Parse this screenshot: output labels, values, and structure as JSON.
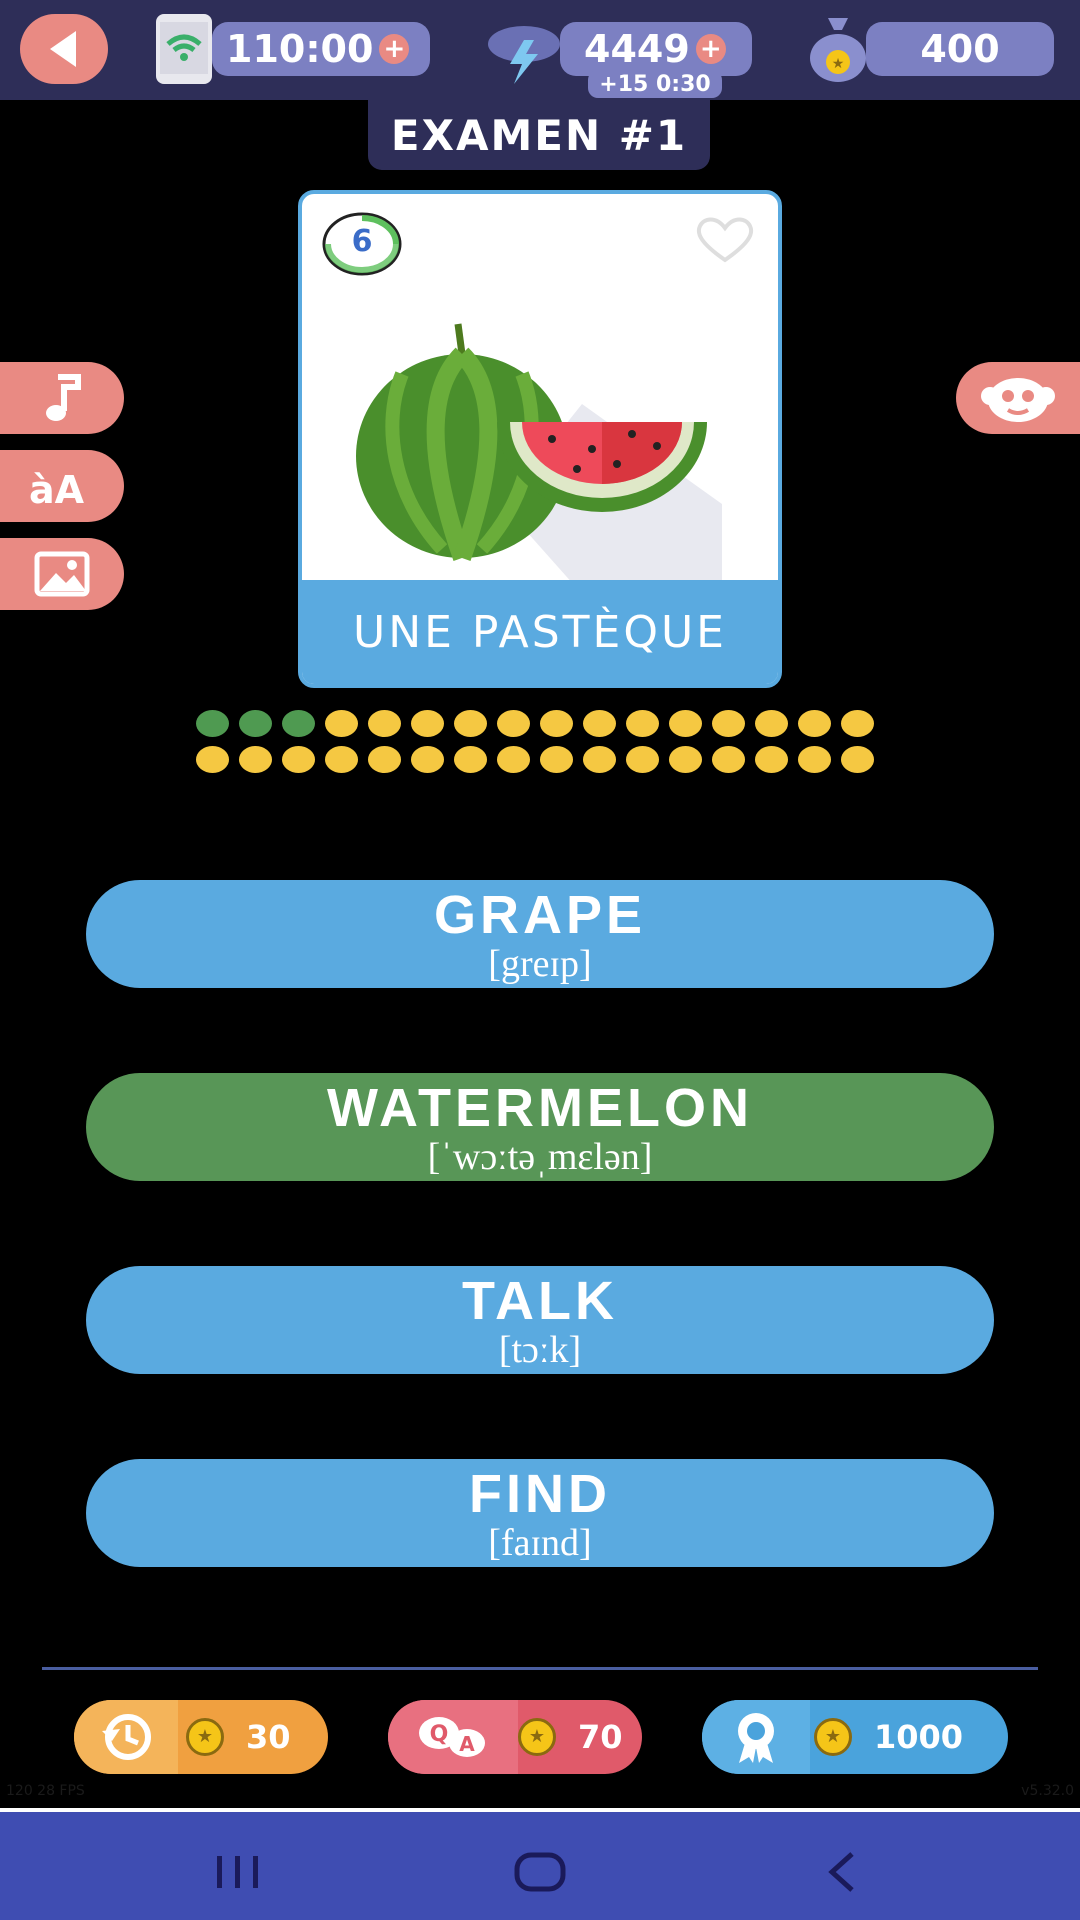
{
  "status_bar": {
    "back_icon": "back-arrow-icon",
    "timer": "110:00",
    "energy": "4449",
    "energy_refill": "+15 0:30",
    "coins": "400",
    "plus_symbol": "+"
  },
  "exam_title": "EXAMEN #1",
  "card": {
    "level": "6",
    "word": "UNE PASTÈQUE",
    "image": "watermelon"
  },
  "side_tools": {
    "left": [
      "music-note-icon",
      "translate-icon",
      "image-icon"
    ],
    "right": "mascot-icon"
  },
  "progress": {
    "total": 32,
    "completed": 3,
    "colors": {
      "done": "#4f9a51",
      "todo": "#f5c842"
    }
  },
  "answers": [
    {
      "word": "GRAPE",
      "phonetic": "[greɪp]",
      "state": "normal"
    },
    {
      "word": "WATERMELON",
      "phonetic": "[ˈwɔːtəˌmɛlən]",
      "state": "correct"
    },
    {
      "word": "TALK",
      "phonetic": "[tɔːk]",
      "state": "normal"
    },
    {
      "word": "FIND",
      "phonetic": "[faɪnd]",
      "state": "normal"
    }
  ],
  "bonuses": [
    {
      "icon": "time-rewind-icon",
      "cost": "30",
      "color": "#f0a040"
    },
    {
      "icon": "qa-hint-icon",
      "cost": "70",
      "color": "#e05a6a"
    },
    {
      "icon": "award-ribbon-icon",
      "cost": "1000",
      "color": "#4aa3dc"
    }
  ],
  "footer": {
    "left_tiny": "120 28 FPS",
    "right_tiny": "v5.32.0"
  },
  "colors": {
    "topbar": "#2e2e58",
    "pill": "#7c80c2",
    "salmon": "#e98a83",
    "answer_blue": "#5aaae0",
    "answer_green": "#589657",
    "navbar": "#3f4db2"
  }
}
